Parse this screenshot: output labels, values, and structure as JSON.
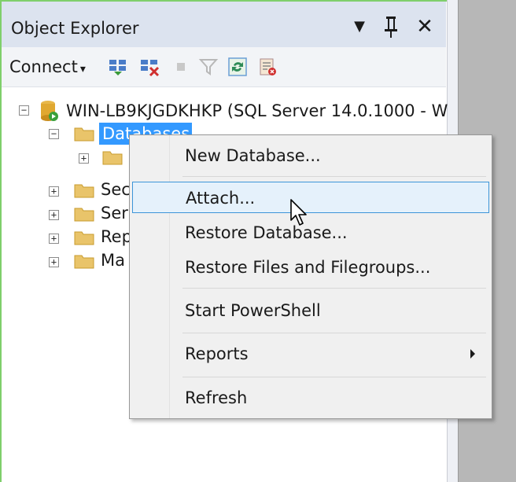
{
  "panel": {
    "title": "Object Explorer",
    "pin_glyph": "Т",
    "dropdown_glyph": "▼",
    "close_glyph": "✕"
  },
  "toolbar": {
    "connect_label": "Connect",
    "connect_arrow": "▾",
    "icons": [
      "connect-object-explorer-icon",
      "disconnect-icon",
      "stop-icon",
      "filter-icon",
      "refresh-icon",
      "activity-monitor-icon"
    ]
  },
  "tree": {
    "server": "WIN-LB9KJGDKHKP (SQL Server 14.0.1000 - W",
    "selected_node": "Databases",
    "collapsed_nodes": [
      "Sec",
      "Ser",
      "Rep",
      "Ma"
    ],
    "expander_expanded": "−",
    "expander_collapsed": "+"
  },
  "context_menu": {
    "items": [
      {
        "label": "New Database..."
      },
      {
        "label": "Attach..."
      },
      {
        "label": "Restore Database..."
      },
      {
        "label": "Restore Files and Filegroups..."
      },
      {
        "label": "Start PowerShell"
      },
      {
        "label": "Reports"
      },
      {
        "label": "Refresh"
      }
    ],
    "hovered_item": "Attach..."
  },
  "colors": {
    "selection": "#3399ff",
    "hover_border": "#3c95d8",
    "hover_fill": "#e5f1fb",
    "titlebar": "#dce3ef",
    "frame_accent": "#7fcf6b"
  }
}
